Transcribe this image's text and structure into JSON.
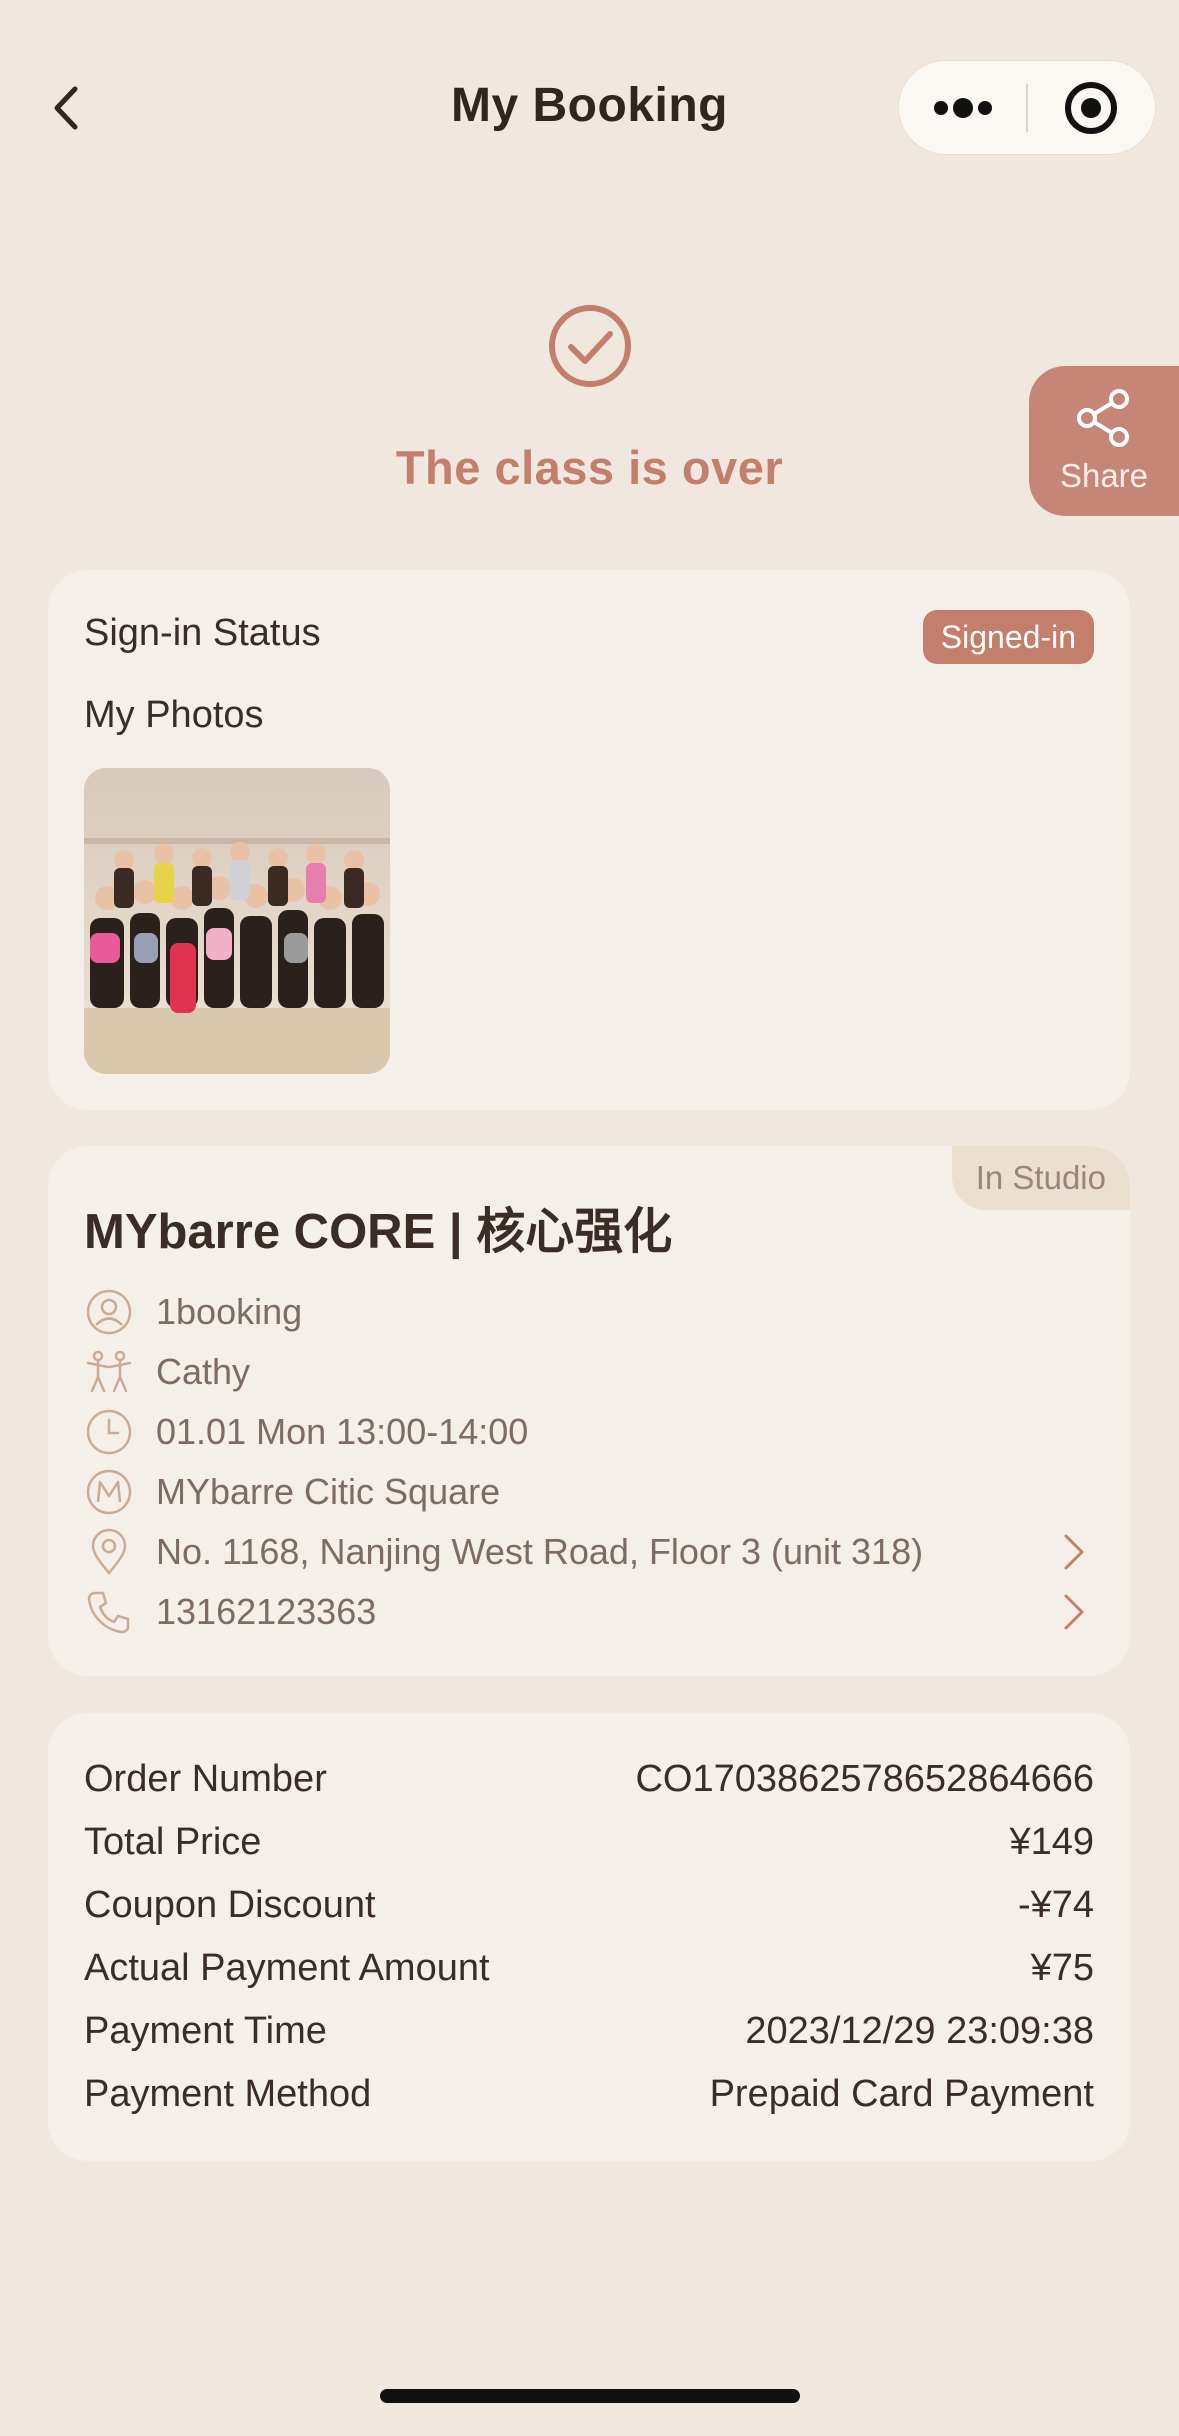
{
  "nav": {
    "title": "My Booking"
  },
  "status": {
    "text": "The class is over"
  },
  "share": {
    "label": "Share"
  },
  "signin": {
    "status_label": "Sign-in Status",
    "badge": "Signed-in",
    "photos_label": "My Photos"
  },
  "class": {
    "tag": "In Studio",
    "title": "MYbarre CORE | 核心强化",
    "booking_source": "1booking",
    "instructor": "Cathy",
    "time": "01.01 Mon 13:00-14:00",
    "studio": "MYbarre Citic Square",
    "address": "No. 1168, Nanjing West Road, Floor 3 (unit 318)",
    "phone": "13162123363"
  },
  "order": {
    "rows": [
      {
        "label": "Order Number",
        "value": "CO1703862578652864666"
      },
      {
        "label": "Total Price",
        "value": "¥149"
      },
      {
        "label": "Coupon Discount",
        "value": "-¥74"
      },
      {
        "label": "Actual Payment Amount",
        "value": "¥75"
      },
      {
        "label": "Payment Time",
        "value": "2023/12/29 23:09:38"
      },
      {
        "label": "Payment Method",
        "value": "Prepaid Card Payment"
      }
    ]
  },
  "colors": {
    "accent": "#c47f6c",
    "background": "#f0e8de",
    "card": "#f4efe8"
  }
}
